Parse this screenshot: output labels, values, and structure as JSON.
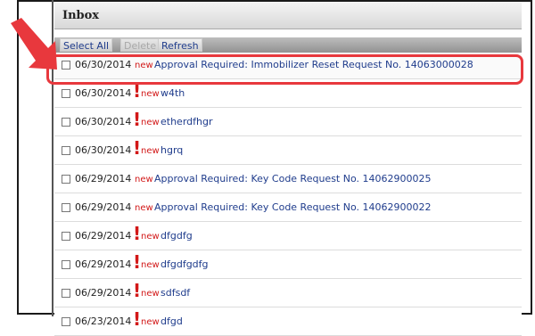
{
  "inbox": {
    "title": "Inbox",
    "toolbar": {
      "select_all": "Select All",
      "delete": "Delete",
      "refresh": "Refresh"
    },
    "messages": [
      {
        "date": "06/30/2014",
        "flag": "",
        "new": "new",
        "subject": "Approval Required: Immobilizer Reset Request No. 14063000028"
      },
      {
        "date": "06/30/2014",
        "flag": "!",
        "new": "new",
        "subject": "w4th"
      },
      {
        "date": "06/30/2014",
        "flag": "!",
        "new": "new",
        "subject": "etherdfhgr"
      },
      {
        "date": "06/30/2014",
        "flag": "!",
        "new": "new",
        "subject": "hgrq"
      },
      {
        "date": "06/29/2014",
        "flag": "",
        "new": "new",
        "subject": "Approval Required: Key Code Request No. 14062900025"
      },
      {
        "date": "06/29/2014",
        "flag": "",
        "new": "new",
        "subject": "Approval Required: Key Code Request No. 14062900022"
      },
      {
        "date": "06/29/2014",
        "flag": "!",
        "new": "new",
        "subject": "dfgdfg"
      },
      {
        "date": "06/29/2014",
        "flag": "!",
        "new": "new",
        "subject": "dfgdfgdfg"
      },
      {
        "date": "06/29/2014",
        "flag": "!",
        "new": "new",
        "subject": "sdfsdf"
      },
      {
        "date": "06/23/2014",
        "flag": "!",
        "new": "new",
        "subject": "dfgd"
      }
    ]
  },
  "colors": {
    "annotation_red": "#e8383d",
    "new_red": "#d21818",
    "link_blue": "#1f3c8c"
  }
}
